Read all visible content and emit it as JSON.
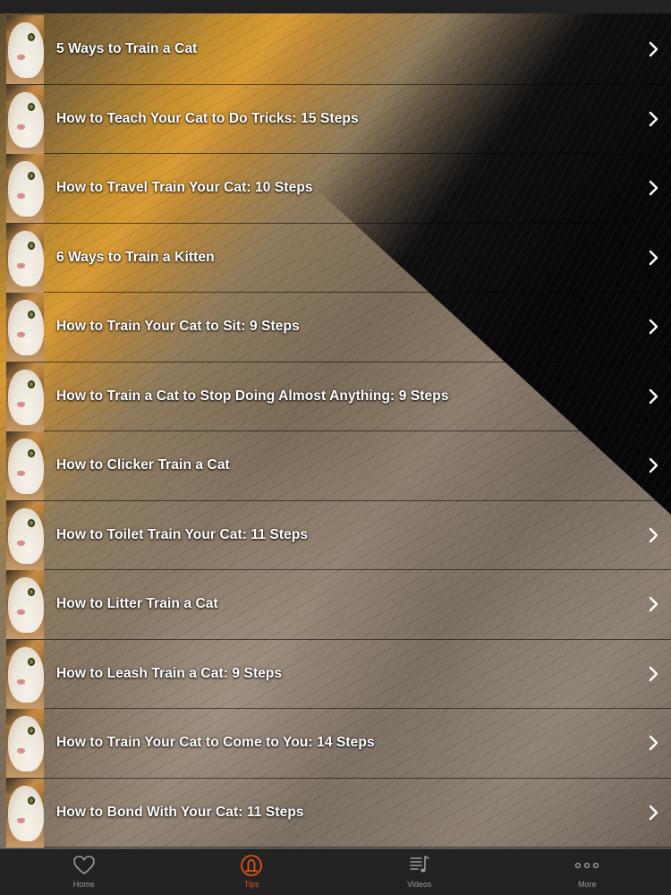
{
  "list": {
    "items": [
      {
        "label": "5 Ways to Train a Cat"
      },
      {
        "label": "How to Teach Your Cat to Do Tricks: 15 Steps"
      },
      {
        "label": "How to Travel Train Your Cat: 10 Steps"
      },
      {
        "label": "6 Ways to Train a Kitten"
      },
      {
        "label": "How to Train Your Cat to Sit: 9 Steps"
      },
      {
        "label": "How to Train a Cat to Stop Doing Almost Anything: 9 Steps"
      },
      {
        "label": "How to Clicker Train a Cat"
      },
      {
        "label": "How to Toilet Train Your Cat: 11 Steps"
      },
      {
        "label": "How to Litter Train a Cat"
      },
      {
        "label": "How to Leash Train a Cat: 9 Steps"
      },
      {
        "label": "How to Train Your Cat to Come to You: 14 Steps"
      },
      {
        "label": "How to Bond With Your Cat: 11 Steps"
      }
    ]
  },
  "tab_bar": {
    "tabs": [
      {
        "label": "Home",
        "icon": "heart-icon"
      },
      {
        "label": "Tips",
        "icon": "tips-icon"
      },
      {
        "label": "Videos",
        "icon": "videos-icon"
      },
      {
        "label": "More",
        "icon": "more-icon"
      }
    ],
    "active_tab": "Tips"
  },
  "colors": {
    "accent": "#e2531a",
    "tab_bar_background": "#222222",
    "inactive_tab": "#9a9a9a",
    "list_text": "#ffffff"
  }
}
